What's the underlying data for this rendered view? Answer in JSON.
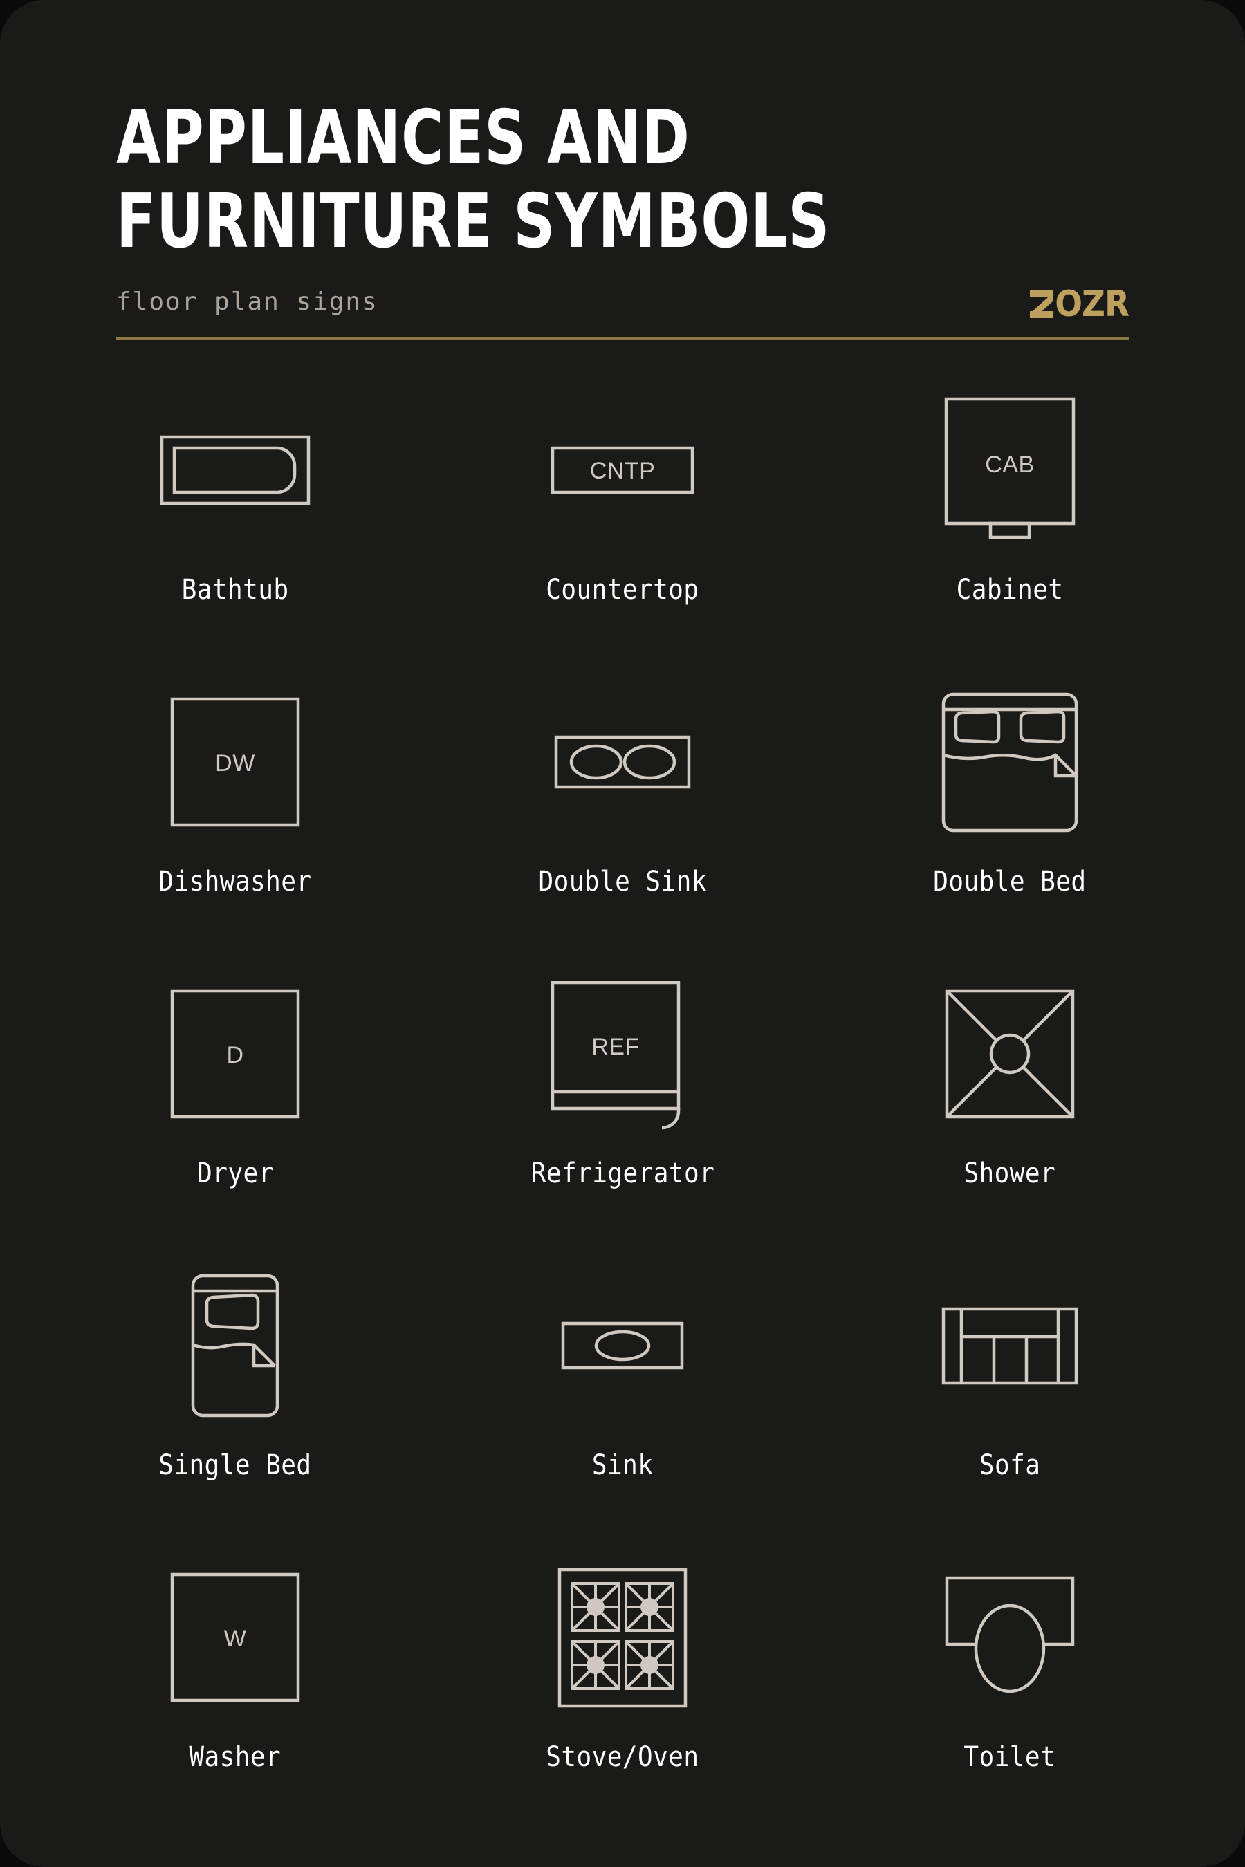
{
  "card": {
    "background_color": "#1a1a19",
    "page_background_color": "#0a0a0a"
  },
  "header": {
    "title": "APPLIANCES AND\nFURNITURE SYMBOLS",
    "subtitle": "floor plan signs",
    "logo_text": "OZR",
    "logo_full": "ZOZR",
    "logo_color": "#bda05e",
    "divider_color": "#8c7741"
  },
  "theme": {
    "stroke_color": "#cfc9c1",
    "label_color": "#ffffff",
    "subtitle_color": "#a9a59e"
  },
  "grid": {
    "columns": 3,
    "rows": 5,
    "items": [
      {
        "id": "bathtub",
        "label": "Bathtub",
        "icon": "bathtub-icon",
        "inner_text": ""
      },
      {
        "id": "countertop",
        "label": "Countertop",
        "icon": "countertop-icon",
        "inner_text": "CNTP"
      },
      {
        "id": "cabinet",
        "label": "Cabinet",
        "icon": "cabinet-icon",
        "inner_text": "CAB"
      },
      {
        "id": "dishwasher",
        "label": "Dishwasher",
        "icon": "dishwasher-icon",
        "inner_text": "DW"
      },
      {
        "id": "double-sink",
        "label": "Double Sink",
        "icon": "double-sink-icon",
        "inner_text": ""
      },
      {
        "id": "double-bed",
        "label": "Double Bed",
        "icon": "double-bed-icon",
        "inner_text": ""
      },
      {
        "id": "dryer",
        "label": "Dryer",
        "icon": "dryer-icon",
        "inner_text": "D"
      },
      {
        "id": "refrigerator",
        "label": "Refrigerator",
        "icon": "refrigerator-icon",
        "inner_text": "REF"
      },
      {
        "id": "shower",
        "label": "Shower",
        "icon": "shower-icon",
        "inner_text": ""
      },
      {
        "id": "single-bed",
        "label": "Single Bed",
        "icon": "single-bed-icon",
        "inner_text": ""
      },
      {
        "id": "sink",
        "label": "Sink",
        "icon": "sink-icon",
        "inner_text": ""
      },
      {
        "id": "sofa",
        "label": "Sofa",
        "icon": "sofa-icon",
        "inner_text": ""
      },
      {
        "id": "washer",
        "label": "Washer",
        "icon": "washer-icon",
        "inner_text": "W"
      },
      {
        "id": "stove-oven",
        "label": "Stove/Oven",
        "icon": "stove-oven-icon",
        "inner_text": ""
      },
      {
        "id": "toilet",
        "label": "Toilet",
        "icon": "toilet-icon",
        "inner_text": ""
      }
    ]
  }
}
